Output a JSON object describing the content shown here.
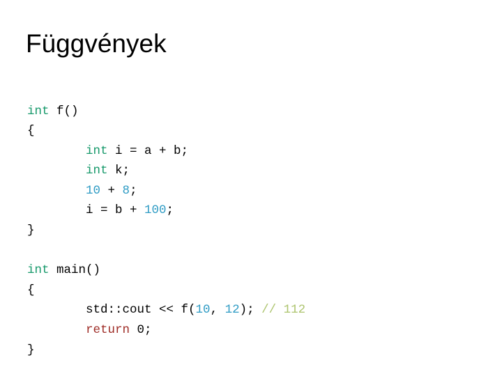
{
  "slide": {
    "title": "Függvények",
    "background_color": "#FFFFFF",
    "title_color": "#000000"
  },
  "syntax_colors": {
    "keyword_type": "#17996B",
    "keyword_control": "#9E2B25",
    "number_literal": "#2E9BC4",
    "comment": "#ADC46E",
    "plain": "#000000"
  },
  "code": {
    "language": "cpp",
    "indent": "        ",
    "lines": [
      {
        "id": "l01",
        "text": "int f()"
      },
      {
        "id": "l02",
        "text": "{"
      },
      {
        "id": "l03",
        "text": "        int i = a + b;"
      },
      {
        "id": "l04",
        "text": "        int k;"
      },
      {
        "id": "l05",
        "text": "        10 + 8;"
      },
      {
        "id": "l06",
        "text": "        i = b + 100;"
      },
      {
        "id": "l07",
        "text": "}"
      },
      {
        "id": "l08",
        "text": ""
      },
      {
        "id": "l09",
        "text": "int main()"
      },
      {
        "id": "l10",
        "text": "{"
      },
      {
        "id": "l11",
        "text": "        std::cout << f(10, 12); // 112"
      },
      {
        "id": "l12",
        "text": "        return 0;"
      },
      {
        "id": "l13",
        "text": "}"
      }
    ],
    "tokens": {
      "l01": [
        {
          "t": "int",
          "c": "keyword_type"
        },
        {
          "t": " f()",
          "c": "plain"
        }
      ],
      "l02": [
        {
          "t": "{",
          "c": "plain"
        }
      ],
      "l03": [
        {
          "t": "        ",
          "c": "plain"
        },
        {
          "t": "int",
          "c": "keyword_type"
        },
        {
          "t": " i = a + b;",
          "c": "plain"
        }
      ],
      "l04": [
        {
          "t": "        ",
          "c": "plain"
        },
        {
          "t": "int",
          "c": "keyword_type"
        },
        {
          "t": " k;",
          "c": "plain"
        }
      ],
      "l05": [
        {
          "t": "        ",
          "c": "plain"
        },
        {
          "t": "10",
          "c": "number_literal"
        },
        {
          "t": " + ",
          "c": "plain"
        },
        {
          "t": "8",
          "c": "number_literal"
        },
        {
          "t": ";",
          "c": "plain"
        }
      ],
      "l06": [
        {
          "t": "        ",
          "c": "plain"
        },
        {
          "t": "i = b + ",
          "c": "plain"
        },
        {
          "t": "100",
          "c": "number_literal"
        },
        {
          "t": ";",
          "c": "plain"
        }
      ],
      "l07": [
        {
          "t": "}",
          "c": "plain"
        }
      ],
      "l08": [],
      "l09": [
        {
          "t": "int",
          "c": "keyword_type"
        },
        {
          "t": " main()",
          "c": "plain"
        }
      ],
      "l10": [
        {
          "t": "{",
          "c": "plain"
        }
      ],
      "l11": [
        {
          "t": "        ",
          "c": "plain"
        },
        {
          "t": "std::cout << f(",
          "c": "plain"
        },
        {
          "t": "10",
          "c": "number_literal"
        },
        {
          "t": ", ",
          "c": "plain"
        },
        {
          "t": "12",
          "c": "number_literal"
        },
        {
          "t": "); ",
          "c": "plain"
        },
        {
          "t": "// 112",
          "c": "comment"
        }
      ],
      "l12": [
        {
          "t": "        ",
          "c": "plain"
        },
        {
          "t": "return",
          "c": "keyword_control"
        },
        {
          "t": " 0;",
          "c": "plain"
        }
      ],
      "l13": [
        {
          "t": "}",
          "c": "plain"
        }
      ]
    }
  }
}
